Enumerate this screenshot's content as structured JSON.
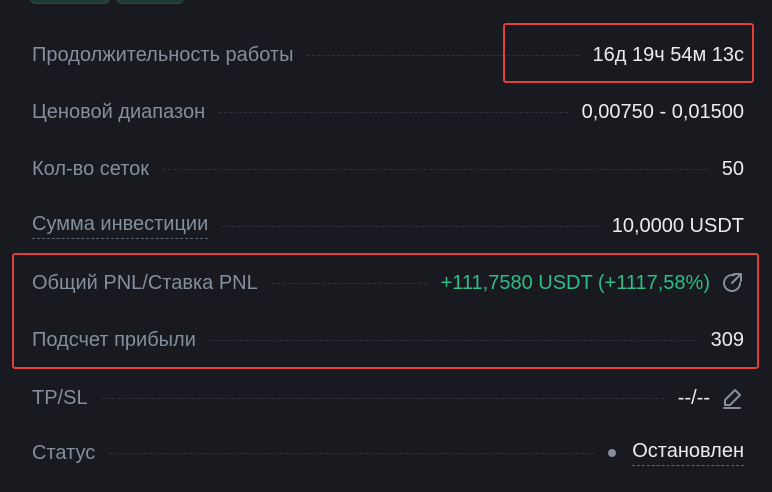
{
  "rows": [
    {
      "label": "Продолжительность работы",
      "value": "16д 19ч 54м 13с"
    },
    {
      "label": "Ценовой диапазон",
      "value": "0,00750 - 0,01500"
    },
    {
      "label": "Кол-во сеток",
      "value": "50"
    },
    {
      "label": "Сумма инвестиции",
      "value": "10,0000 USDT"
    },
    {
      "label": "Общий PNL/Ставка PNL",
      "value": "+111,7580 USDT (+1117,58%)",
      "icon": "share-icon"
    },
    {
      "label": "Подсчет прибыли",
      "value": "309"
    },
    {
      "label": "TP/SL",
      "value": "--/--",
      "icon": "edit-pencil-icon"
    },
    {
      "label": "Статус",
      "value": "Остановлен",
      "icon": "status-dot-icon"
    }
  ],
  "colors": {
    "background": "#181a20",
    "label": "#848e9c",
    "value": "#eaecef",
    "positive": "#2ebd85",
    "highlight": "#e0403a"
  }
}
